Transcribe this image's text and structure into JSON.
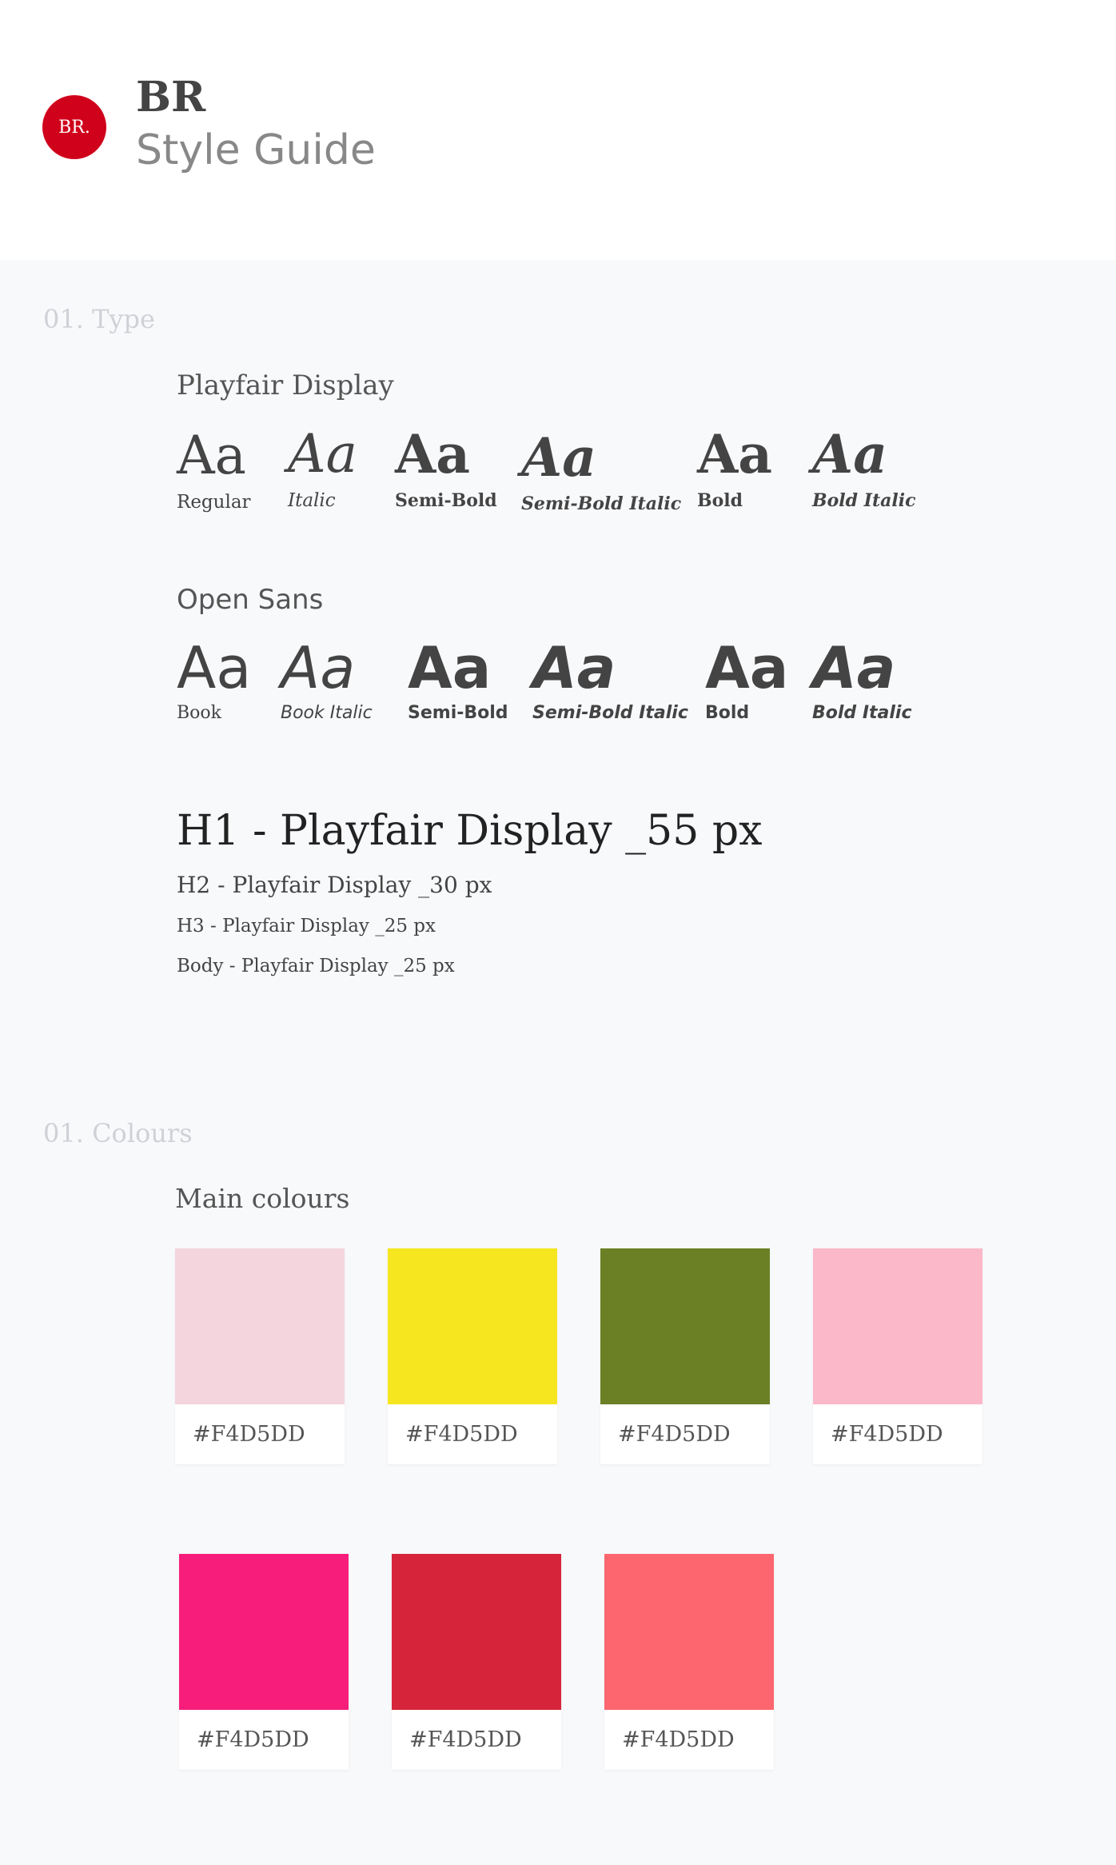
{
  "header": {
    "logo_text": "BR.",
    "title": "BR",
    "subtitle": "Style Guide",
    "logo_color": "#d0021b"
  },
  "type_section": {
    "label": "01. Type",
    "playfair": {
      "name": "Playfair Display",
      "samples": [
        {
          "glyph": "Aa",
          "label": "Regular"
        },
        {
          "glyph": "Aa",
          "label": "Italic"
        },
        {
          "glyph": "Aa",
          "label": "Semi-Bold"
        },
        {
          "glyph": "Aa",
          "label": "Semi-Bold Italic"
        },
        {
          "glyph": "Aa",
          "label": "Bold"
        },
        {
          "glyph": "Aa",
          "label": "Bold Italic"
        }
      ]
    },
    "opensans": {
      "name": "Open Sans",
      "samples": [
        {
          "glyph": "Aa",
          "label": "Book"
        },
        {
          "glyph": "Aa",
          "label": "Book Italic"
        },
        {
          "glyph": "Aa",
          "label": "Semi-Bold"
        },
        {
          "glyph": "Aa",
          "label": "Semi-Bold Italic"
        },
        {
          "glyph": "Aa",
          "label": "Bold"
        },
        {
          "glyph": "Aa",
          "label": "Bold Italic"
        }
      ]
    },
    "scale": {
      "h1": "H1 - Playfair Display _55 px",
      "h2": "H2 - Playfair Display _30 px",
      "h3": "H3 - Playfair Display _25 px",
      "body": "Body - Playfair Display _25 px"
    }
  },
  "colour_section": {
    "label": "01. Colours",
    "subtitle": "Main colours",
    "swatches": [
      {
        "color": "#F4D5DD",
        "hex": "#F4D5DD"
      },
      {
        "color": "#F6E620",
        "hex": "#F4D5DD"
      },
      {
        "color": "#6B8024",
        "hex": "#F4D5DD"
      },
      {
        "color": "#FBB8C9",
        "hex": "#F4D5DD"
      },
      {
        "color": "#F71E7B",
        "hex": "#F4D5DD"
      },
      {
        "color": "#D6253B",
        "hex": "#F4D5DD"
      },
      {
        "color": "#FD666E",
        "hex": "#F4D5DD"
      }
    ]
  }
}
